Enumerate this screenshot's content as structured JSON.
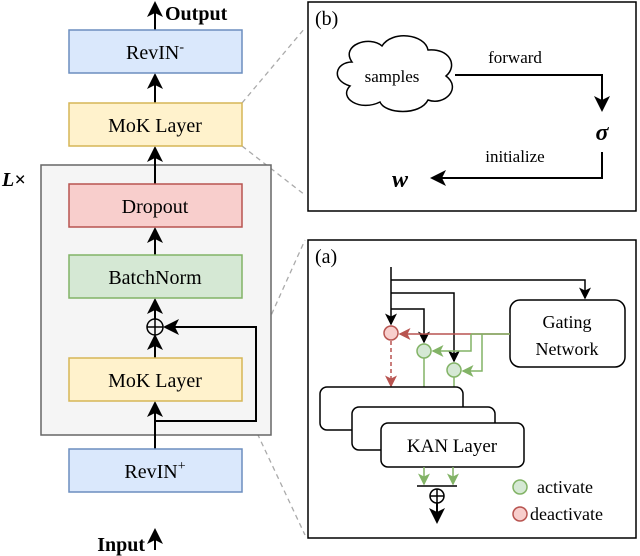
{
  "left": {
    "output_label": "Output",
    "input_label": "Input",
    "repeat_label": "L×",
    "revin_out": "RevIN",
    "revin_out_sup": "-",
    "mok_top": "MoK Layer",
    "dropout": "Dropout",
    "batchnorm": "BatchNorm",
    "mok_bottom": "MoK Layer",
    "revin_in": "RevIN",
    "revin_in_sup": "+"
  },
  "panel_b": {
    "tag": "(b)",
    "cloud": "samples",
    "forward": "forward",
    "sigma": "σ",
    "initialize": "initialize",
    "w": "w"
  },
  "panel_a": {
    "tag": "(a)",
    "gating_line1": "Gating",
    "gating_line2": "Network",
    "kan": "KAN Layer",
    "legend_activate": "activate",
    "legend_deactivate": "deactivate"
  },
  "colors": {
    "blue_fill": "#dae8fc",
    "blue_stroke": "#6c8ebf",
    "yellow_fill": "#fff2cc",
    "yellow_stroke": "#d6b656",
    "red_fill": "#f8cecc",
    "red_stroke": "#b85450",
    "green_fill": "#d5e8d4",
    "green_stroke": "#82b366"
  }
}
